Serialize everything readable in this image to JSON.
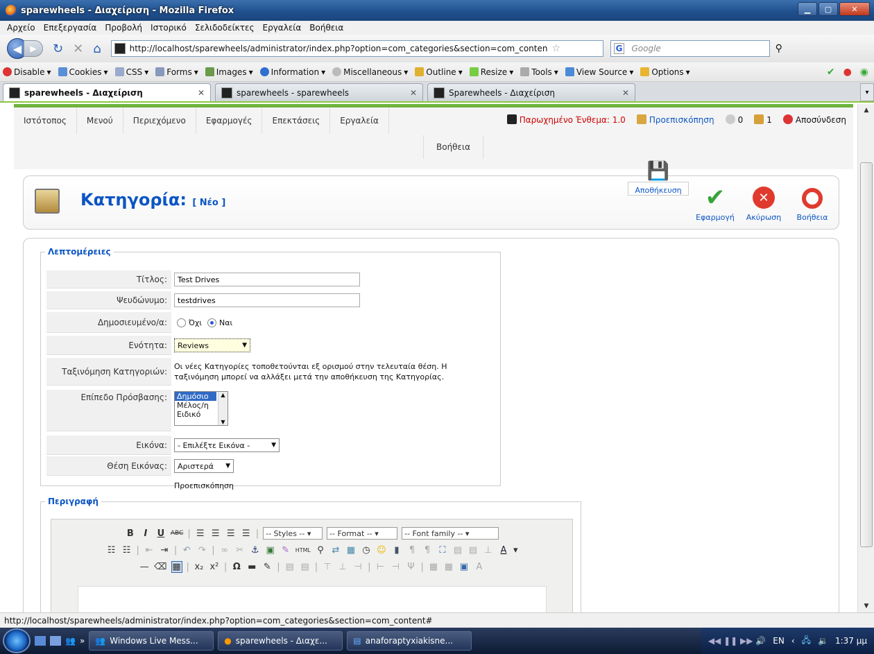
{
  "window": {
    "title": "sparewheels - Διαχείριση - Mozilla Firefox"
  },
  "menubar": [
    "Αρχείο",
    "Επεξεργασία",
    "Προβολή",
    "Ιστορικό",
    "Σελιδοδείκτες",
    "Εργαλεία",
    "Βοήθεια"
  ],
  "address": {
    "url": "http://localhost/sparewheels/administrator/index.php?option=com_categories&section=com_conten",
    "search_placeholder": "Google"
  },
  "devbar": [
    "Disable",
    "Cookies",
    "CSS",
    "Forms",
    "Images",
    "Information",
    "Miscellaneous",
    "Outline",
    "Resize",
    "Tools",
    "View Source",
    "Options"
  ],
  "tabs": [
    {
      "label": "sparewheels - Διαχείριση"
    },
    {
      "label": "sparewheels - sparewheels"
    },
    {
      "label": "Sparewheels - Διαχείριση"
    }
  ],
  "joomla_menu": [
    "Ιστότοπος",
    "Μενού",
    "Περιεχόμενο",
    "Εφαρμογές",
    "Επεκτάσεις",
    "Εργαλεία"
  ],
  "joomla_menu_help": "Βοήθεια",
  "status": {
    "checked_out": "Παρωχημένο Ένθεμα: 1.0",
    "preview": "Προεπισκόπηση",
    "messages": "0",
    "users": "1",
    "logout": "Αποσύνδεση"
  },
  "header": {
    "title": "Κατηγορία:",
    "subtitle": "[ Νέο ]"
  },
  "toolbar": {
    "save": "Αποθήκευση",
    "apply": "Εφαρμογή",
    "cancel": "Ακύρωση",
    "help": "Βοήθεια"
  },
  "details": {
    "legend": "Λεπτομέρειες",
    "title_label": "Τίτλος:",
    "title_value": "Test Drives",
    "alias_label": "Ψευδώνυμο:",
    "alias_value": "testdrives",
    "published_label": "Δημοσιευμένο/α:",
    "no": "Όχι",
    "yes": "Ναι",
    "section_label": "Ενότητα:",
    "section_value": "Reviews",
    "order_label": "Ταξινόμηση Κατηγοριών:",
    "order_text": "Οι νέες Κατηγορίες τοποθετούνται εξ ορισμού στην τελευταία θέση. Η ταξινόμηση μπορεί να αλλάξει μετά την αποθήκευση της Κατηγορίας.",
    "access_label": "Επίπεδο Πρόσβασης:",
    "access_options": [
      "Δημόσιο",
      "Μέλος/η",
      "Ειδικό"
    ],
    "image_label": "Εικόνα:",
    "image_value": "- Επιλέξτε Εικόνα -",
    "imagepos_label": "Θέση Εικόνας:",
    "imagepos_value": "Αριστερά",
    "preview": "Προεπισκόπηση"
  },
  "description": {
    "legend": "Περιγραφή",
    "styles": "-- Styles --",
    "format": "-- Format --",
    "fontfamily": "-- Font family --"
  },
  "statusbar": "http://localhost/sparewheels/administrator/index.php?option=com_categories&section=com_content#",
  "taskbar": {
    "items": [
      "Windows Live Mess...",
      "sparewheels - Διαχε...",
      "anaforaptyxiakisne..."
    ],
    "lang": "EN",
    "time": "1:37 μμ"
  }
}
